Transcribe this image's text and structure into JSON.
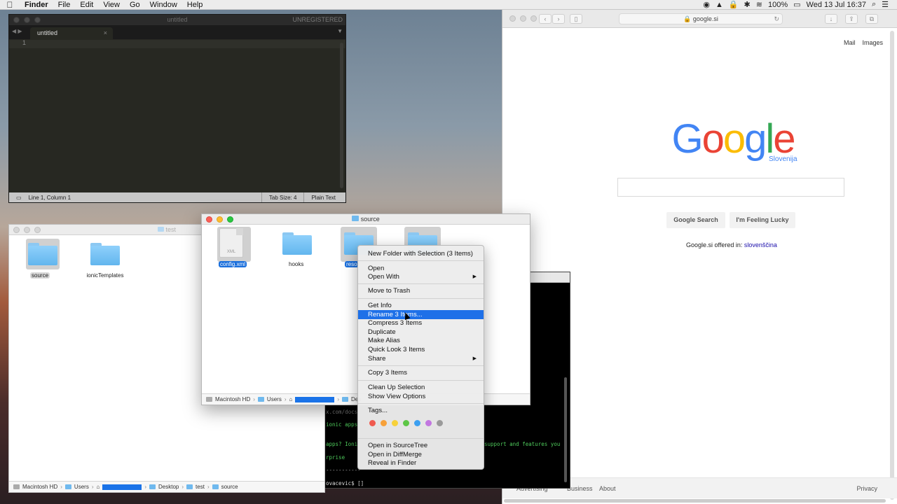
{
  "menubar": {
    "app": "Finder",
    "items": [
      "File",
      "Edit",
      "View",
      "Go",
      "Window",
      "Help"
    ],
    "battery": "100%",
    "clock": "Wed 13 Jul  16:37"
  },
  "sublime": {
    "title": "untitled",
    "unregistered": "UNREGISTERED",
    "tab": "untitled",
    "line_number": "1",
    "status_position": "Line 1, Column 1",
    "tab_size": "Tab Size: 4",
    "syntax": "Plain Text"
  },
  "safari": {
    "address": "google.si",
    "top_links": [
      "Mail",
      "Images"
    ],
    "region": "Slovenija",
    "search_button": "Google Search",
    "lucky_button": "I'm Feeling Lucky",
    "offered_text": "Google.si offered in:",
    "offered_lang": "slovenščina",
    "footer": {
      "advertising": "Advertising",
      "business": "Business",
      "about": "About",
      "privacy": "Privacy"
    }
  },
  "terminal": {
    "lines": [
      "x.com/docs",
      "ionic apps",
      "apps? Ioni",
      "rprise",
      "-----------",
      "ovacevic$ []"
    ],
    "right_text": "support and features you"
  },
  "test_window": {
    "title": "test",
    "items": [
      {
        "label": "source"
      },
      {
        "label": "ionicTemplates"
      }
    ],
    "path": [
      "Macintosh HD",
      "Users",
      "Desktop",
      "test",
      "source"
    ]
  },
  "source_window": {
    "title": "source",
    "items": [
      {
        "label": "config.xml",
        "file_badge": "XML"
      },
      {
        "label": "hooks"
      },
      {
        "label": "reso"
      },
      {
        "label": ""
      }
    ],
    "path": [
      "Macintosh HD",
      "Users",
      "Des"
    ]
  },
  "context_menu": {
    "items": [
      {
        "label": "New Folder with Selection (3 Items)"
      },
      {
        "label": "Open"
      },
      {
        "label": "Open With",
        "submenu": true
      },
      {
        "label": "Move to Trash"
      },
      {
        "label": "Get Info"
      },
      {
        "label": "Rename 3 Items...",
        "highlighted": true
      },
      {
        "label": "Compress 3 Items"
      },
      {
        "label": "Duplicate"
      },
      {
        "label": "Make Alias"
      },
      {
        "label": "Quick Look 3 Items"
      },
      {
        "label": "Share",
        "submenu": true
      },
      {
        "label": "Copy 3 Items"
      },
      {
        "label": "Clean Up Selection"
      },
      {
        "label": "Show View Options"
      },
      {
        "label": "Tags..."
      },
      {
        "label": "Open in SourceTree"
      },
      {
        "label": "Open in DiffMerge"
      },
      {
        "label": "Reveal in Finder"
      }
    ],
    "tag_colors": [
      "#f05a4f",
      "#f7a13a",
      "#f7d13a",
      "#5dc646",
      "#3c9ff0",
      "#c277e0",
      "#9a9a9a"
    ]
  }
}
